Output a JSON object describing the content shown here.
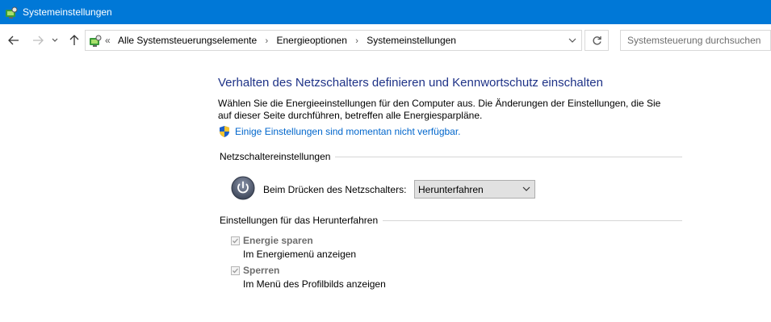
{
  "window": {
    "title": "Systemeinstellungen",
    "app_icon": "control-panel-icon"
  },
  "navigation": {
    "back_icon": "arrow-left-icon",
    "forward_icon": "arrow-right-icon",
    "recent_icon": "chevron-down-icon",
    "up_icon": "arrow-up-icon"
  },
  "address_bar": {
    "overflow": "«",
    "breadcrumbs": [
      "Alle Systemsteuerungselemente",
      "Energieoptionen",
      "Systemeinstellungen"
    ],
    "dropdown_icon": "chevron-down-icon",
    "refresh_icon": "refresh-icon"
  },
  "search": {
    "placeholder": "Systemsteuerung durchsuchen"
  },
  "main": {
    "heading": "Verhalten des Netzschalters definieren und Kennwortschutz einschalten",
    "description": "Wählen Sie die Energieeinstellungen für den Computer aus. Die Änderungen der Einstellungen, die Sie auf dieser Seite durchführen, betreffen alle Energiesparpläne.",
    "admin_link": "Einige Einstellungen sind momentan nicht verfügbar.",
    "admin_icon": "uac-shield-icon"
  },
  "power_button_section": {
    "title": "Netzschaltereinstellungen",
    "label": "Beim Drücken des Netzschalters:",
    "selected_option": "Herunterfahren",
    "icon": "power-icon"
  },
  "shutdown_section": {
    "title": "Einstellungen für das Herunterfahren",
    "options": [
      {
        "label": "Energie sparen",
        "description": "Im Energiemenü anzeigen",
        "checked": true,
        "enabled": false
      },
      {
        "label": "Sperren",
        "description": "Im Menü des Profilbilds anzeigen",
        "checked": true,
        "enabled": false
      }
    ]
  },
  "colors": {
    "titlebar": "#0078d7",
    "heading": "#1e3287",
    "link": "#0066cc",
    "disabled_text": "#6d6d6d"
  }
}
